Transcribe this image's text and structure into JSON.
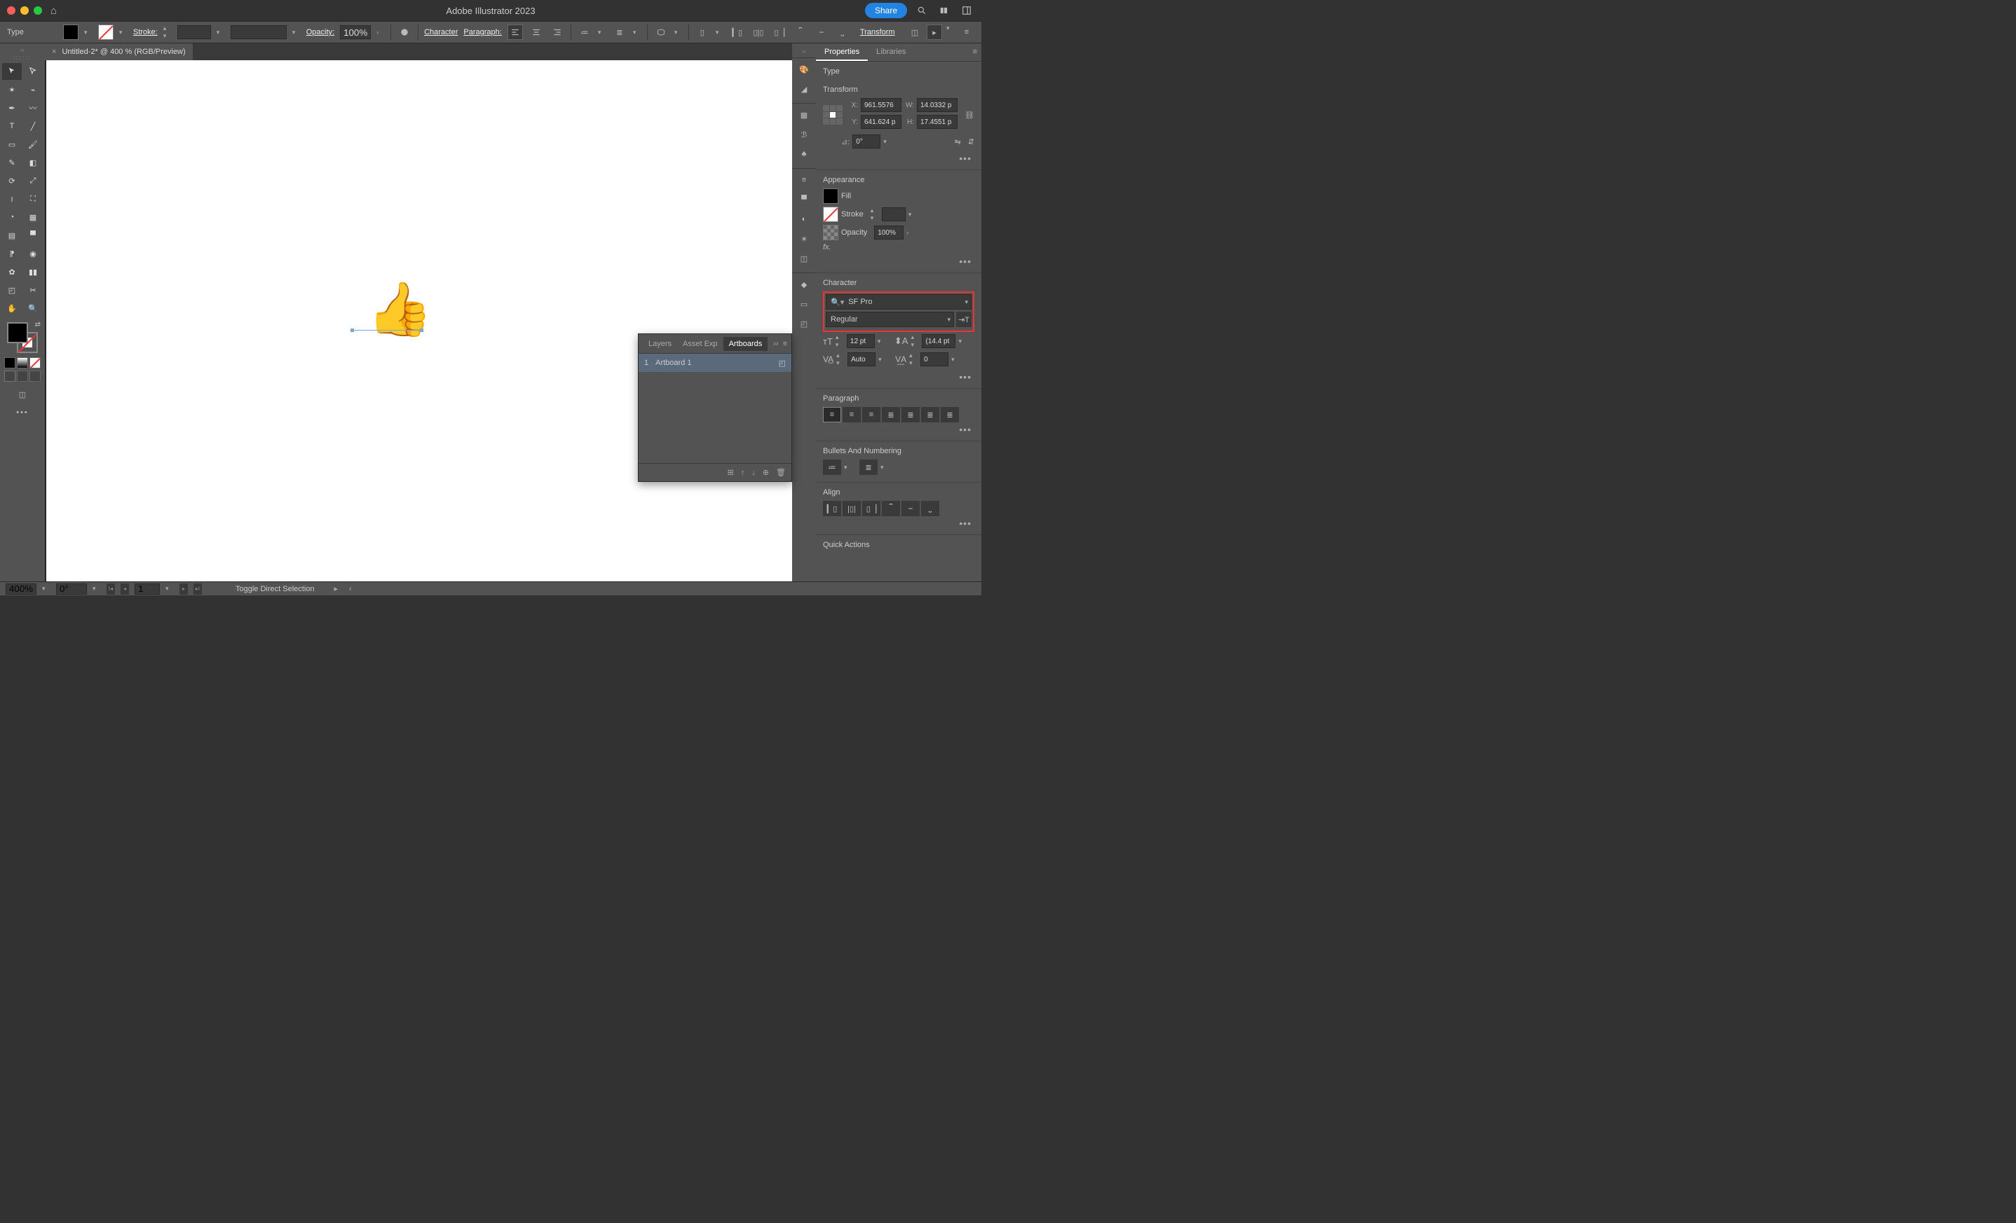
{
  "titlebar": {
    "app_title": "Adobe Illustrator 2023",
    "share": "Share"
  },
  "controlbar": {
    "selection_type": "Type",
    "stroke_label": "Stroke:",
    "opacity_label": "Opacity:",
    "opacity_value": "100%",
    "character_link": "Character",
    "paragraph_link": "Paragraph:",
    "transform_link": "Transform"
  },
  "doc": {
    "tab_title": "Untitled-2* @ 400 % (RGB/Preview)"
  },
  "panel_float": {
    "tabs": [
      "Layers",
      "Asset Exp",
      "Artboards"
    ],
    "active": "Artboards",
    "row_num": "1",
    "row_name": "Artboard 1"
  },
  "props": {
    "tabs": [
      "Properties",
      "Libraries"
    ],
    "type_label": "Type",
    "transform": {
      "title": "Transform",
      "x": "961.5576",
      "y": "641.624 p",
      "w": "14.0332 p",
      "h": "17.4551 p",
      "angle": "0°"
    },
    "appearance": {
      "title": "Appearance",
      "fill": "Fill",
      "stroke": "Stroke",
      "opacity": "Opacity",
      "opacity_val": "100%",
      "fx": "fx."
    },
    "character": {
      "title": "Character",
      "font": "SF Pro",
      "style": "Regular",
      "size": "12 pt",
      "leading": "(14.4 pt",
      "kerning": "Auto",
      "tracking": "0"
    },
    "paragraph": {
      "title": "Paragraph"
    },
    "bullets": {
      "title": "Bullets And Numbering"
    },
    "align": {
      "title": "Align"
    },
    "quick": {
      "title": "Quick Actions"
    }
  },
  "statusbar": {
    "zoom": "400%",
    "rot": "0°",
    "ab": "1",
    "hint": "Toggle Direct Selection"
  }
}
